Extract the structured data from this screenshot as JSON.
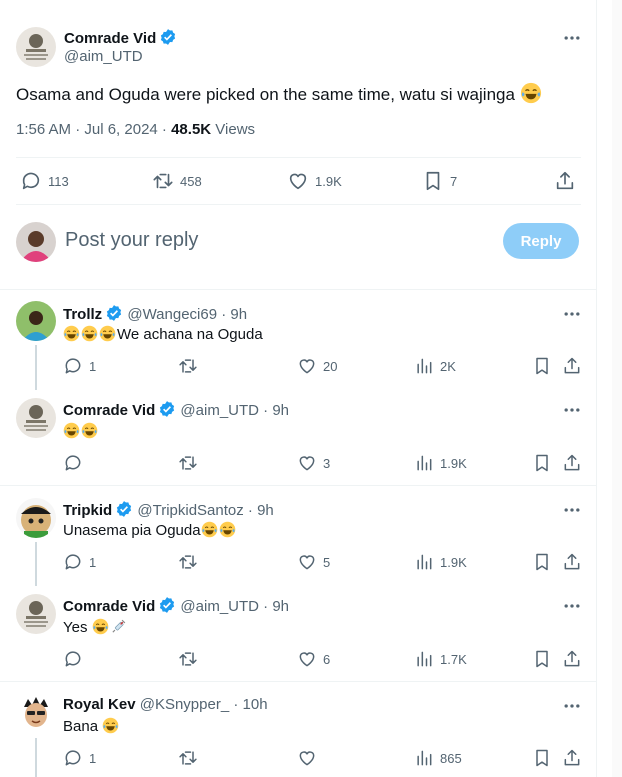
{
  "main_tweet": {
    "author_name": "Comrade Vid",
    "author_handle": "@aim_UTD",
    "text": "Osama and Oguda were picked on the same time, watu si wajinga",
    "time": "1:56 AM · Jul 6, 2024 · ",
    "views_count": "48.5K",
    "views_label": " Views",
    "replies": "113",
    "reposts": "458",
    "likes": "1.9K",
    "bookmarks": "7"
  },
  "composer": {
    "placeholder": "Post your reply",
    "button": "Reply"
  },
  "replies": [
    {
      "name": "Trollz",
      "verified": true,
      "handle": "@Wangeci69",
      "time": "· 9h",
      "text": "We achana na Oguda",
      "replies": "1",
      "likes": "20",
      "views": "2K"
    },
    {
      "name": "Comrade Vid",
      "verified": true,
      "handle": "@aim_UTD",
      "time": "· 9h",
      "text": "",
      "replies": "",
      "likes": "3",
      "views": "1.9K"
    },
    {
      "name": "Tripkid",
      "verified": true,
      "handle": "@TripkidSantoz",
      "time": "· 9h",
      "text": "Unasema pia Oguda",
      "replies": "1",
      "likes": "5",
      "views": "1.9K"
    },
    {
      "name": "Comrade Vid",
      "verified": true,
      "handle": "@aim_UTD",
      "time": "· 9h",
      "text": "Yes",
      "replies": "",
      "likes": "6",
      "views": "1.7K"
    },
    {
      "name": "Royal Kev",
      "verified": false,
      "handle": "@KSnypper_",
      "time": "· 10h",
      "text": "Bana",
      "replies": "1",
      "likes": "",
      "views": "865"
    }
  ],
  "colors": {
    "accent": "#1d9bf0",
    "reply_button": "#8ecdf8",
    "muted": "#536471"
  }
}
